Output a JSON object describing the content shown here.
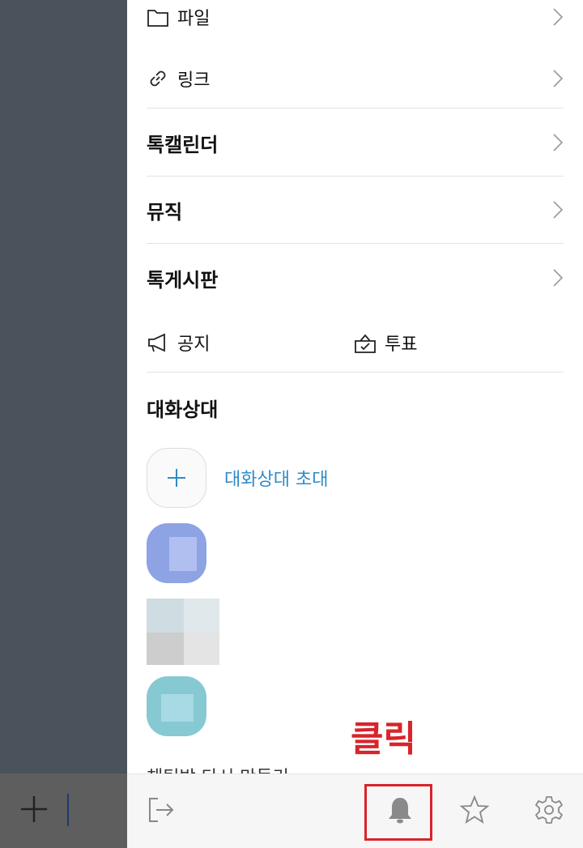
{
  "drawer": {
    "menu": {
      "files": "파일",
      "links": "링크",
      "calendar": "톡캘린더",
      "music": "뮤직",
      "board": "톡게시판",
      "notice": "공지",
      "vote": "투표"
    },
    "members": {
      "title": "대화상대",
      "invite_label": "대화상대 초대"
    },
    "partial_row": "채팅방 다시 만들기"
  },
  "annotation": {
    "text": "클릭",
    "color": "#d8242a"
  },
  "toolbar": {
    "icons": [
      "exit-icon",
      "bell-icon",
      "star-icon",
      "gear-icon"
    ]
  },
  "colors": {
    "accent": "#2f8bc6",
    "highlight": "#d8242a",
    "overlay": "#4a535b"
  }
}
